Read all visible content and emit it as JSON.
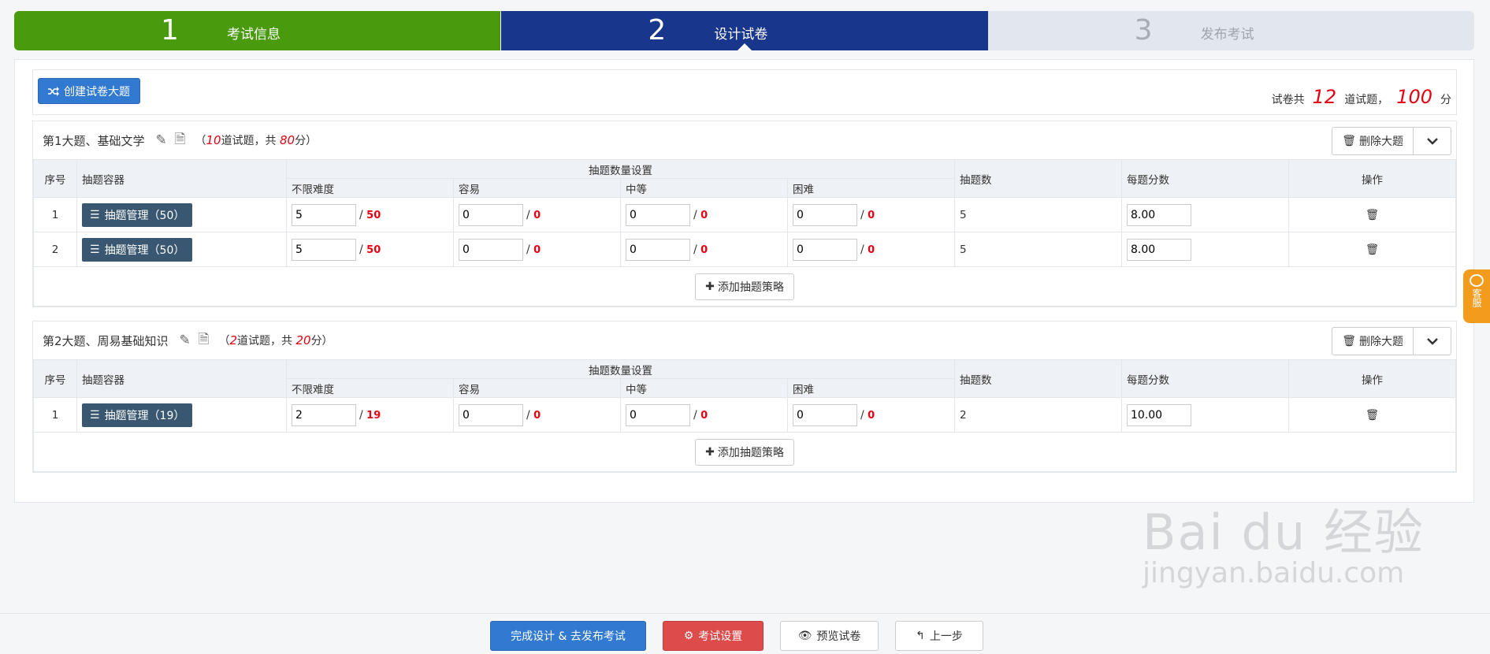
{
  "steps": [
    {
      "num": "1",
      "label": "考试信息"
    },
    {
      "num": "2",
      "label": "设计试卷"
    },
    {
      "num": "3",
      "label": "发布考试"
    }
  ],
  "toolbar": {
    "create_label": "创建试卷大题",
    "summary_prefix": "试卷共",
    "total_questions": "12",
    "summary_mid": "道试题，",
    "total_score": "100",
    "summary_suffix": "分"
  },
  "table_headers": {
    "idx": "序号",
    "pool": "抽题容器",
    "group": "抽题数量设置",
    "any": "不限难度",
    "easy": "容易",
    "medium": "中等",
    "hard": "困难",
    "count": "抽题数",
    "score": "每题分数",
    "op": "操作"
  },
  "sections": [
    {
      "title": "第1大题、基础文学",
      "meta_open": "（",
      "count": "10",
      "meta_mid": "道试题，共",
      "score": "80",
      "meta_close": "分）",
      "delete_label": "删除大题",
      "add_label": "添加抽题策略",
      "rows": [
        {
          "idx": "1",
          "pool": "抽题管理（50）",
          "any": "5",
          "any_max": "50",
          "easy": "0",
          "easy_max": "0",
          "medium": "0",
          "medium_max": "0",
          "hard": "0",
          "hard_max": "0",
          "count": "5",
          "score": "8.00"
        },
        {
          "idx": "2",
          "pool": "抽题管理（50）",
          "any": "5",
          "any_max": "50",
          "easy": "0",
          "easy_max": "0",
          "medium": "0",
          "medium_max": "0",
          "hard": "0",
          "hard_max": "0",
          "count": "5",
          "score": "8.00"
        }
      ]
    },
    {
      "title": "第2大题、周易基础知识",
      "meta_open": "（",
      "count": "2",
      "meta_mid": "道试题，共",
      "score": "20",
      "meta_close": "分）",
      "delete_label": "删除大题",
      "add_label": "添加抽题策略",
      "rows": [
        {
          "idx": "1",
          "pool": "抽题管理（19）",
          "any": "2",
          "any_max": "19",
          "easy": "0",
          "easy_max": "0",
          "medium": "0",
          "medium_max": "0",
          "hard": "0",
          "hard_max": "0",
          "count": "2",
          "score": "10.00"
        }
      ]
    }
  ],
  "bottom": {
    "finish": "完成设计 & 去发布考试",
    "settings": "考试设置",
    "preview": "预览试卷",
    "prev": "上一步"
  },
  "service_tab": "客服",
  "watermark": {
    "logo": "Bai du 经验",
    "url": "jingyan.baidu.com"
  },
  "colors": {
    "step1": "#4a9a0e",
    "step2": "#18368b",
    "step3": "#e2e6ed",
    "primary": "#3279d1",
    "danger": "#dd4b4b",
    "red": "#e60012"
  }
}
